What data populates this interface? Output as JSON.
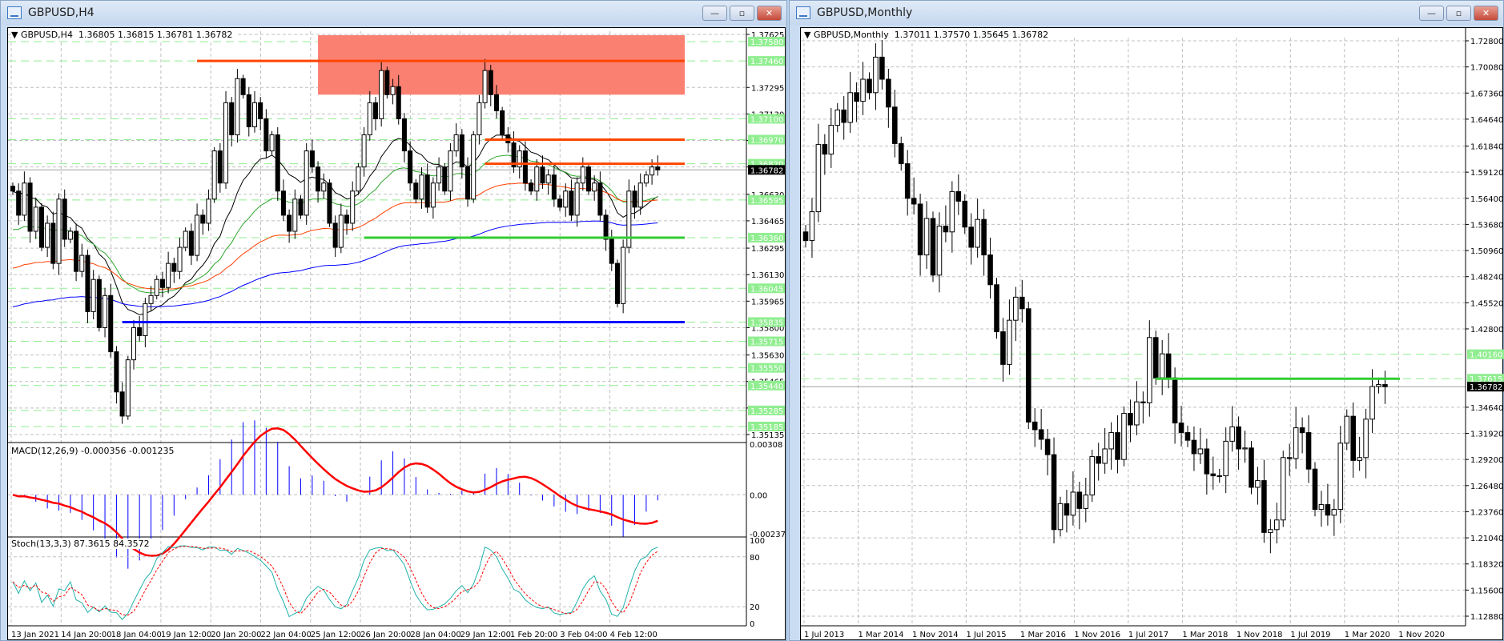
{
  "left_window": {
    "title": "GBPUSD,H4",
    "header": {
      "symbol": "GBPUSD,H4",
      "ohlc": "1.36805 1.36815 1.36781 1.36782"
    },
    "buttons": {
      "minimize": "—",
      "restore": "▫",
      "close": "✕"
    },
    "macd_label": "MACD(12,26,9) -0.000356 -0.001235",
    "stoch_label": "Stoch(13,3,3) 87.3615 84.3572",
    "macd_axis": [
      "0.00308",
      "0.00",
      "-0.00237"
    ],
    "stoch_axis": [
      "100",
      "80",
      "20",
      "0"
    ],
    "current_price": "1.36782",
    "colors": {
      "resist": "#ff4500",
      "zone": "#fa8072",
      "support_green": "#32cd32",
      "support_blue": "#0000ff",
      "level": "#90ee90"
    }
  },
  "right_window": {
    "title": "GBPUSD,Monthly",
    "header": {
      "symbol": "GBPUSD,Monthly",
      "ohlc": "1.37011 1.37570 1.35645 1.36782"
    },
    "buttons": {
      "minimize": "—",
      "restore": "▫",
      "close": "✕"
    },
    "current_price": "1.36782"
  },
  "chart_data": [
    {
      "type": "candlestick",
      "title": "GBPUSD,H4",
      "ylim": [
        1.35135,
        1.37625
      ],
      "y_ticks": [
        "1.37625",
        "1.37295",
        "1.37130",
        "1.36965",
        "1.36800",
        "1.36630",
        "1.36465",
        "1.36295",
        "1.36130",
        "1.35965",
        "1.35800",
        "1.35630",
        "1.35465",
        "1.35300",
        "1.35135"
      ],
      "level_labels": [
        "1.37580",
        "1.37460",
        "1.37100",
        "1.36970",
        "1.36820",
        "1.36595",
        "1.36360",
        "1.36045",
        "1.35835",
        "1.35715",
        "1.35550",
        "1.35440",
        "1.35285",
        "1.35185"
      ],
      "x_labels": [
        "13 Jan 2021",
        "14 Jan 20:00",
        "18 Jan 04:00",
        "19 Jan 12:00",
        "20 Jan 20:00",
        "22 Jan 04:00",
        "25 Jan 12:00",
        "26 Jan 20:00",
        "28 Jan 04:00",
        "29 Jan 12:00",
        "1 Feb 20:00",
        "3 Feb 04:00",
        "4 Feb 12:00"
      ],
      "closes": [
        1.3665,
        1.365,
        1.367,
        1.364,
        1.3655,
        1.363,
        1.3645,
        1.362,
        1.366,
        1.3635,
        1.364,
        1.3615,
        1.3625,
        1.359,
        1.361,
        1.358,
        1.36,
        1.3565,
        1.354,
        1.3525,
        1.356,
        1.358,
        1.3575,
        1.3595,
        1.36,
        1.361,
        1.3605,
        1.362,
        1.3615,
        1.363,
        1.364,
        1.3625,
        1.365,
        1.3645,
        1.366,
        1.369,
        1.367,
        1.372,
        1.37,
        1.3735,
        1.3725,
        1.3705,
        1.372,
        1.371,
        1.369,
        1.37,
        1.3665,
        1.365,
        1.364,
        1.366,
        1.365,
        1.369,
        1.368,
        1.3665,
        1.367,
        1.3645,
        1.363,
        1.365,
        1.3645,
        1.3665,
        1.368,
        1.37,
        1.372,
        1.371,
        1.374,
        1.3725,
        1.373,
        1.371,
        1.369,
        1.367,
        1.366,
        1.3675,
        1.3655,
        1.367,
        1.368,
        1.3665,
        1.369,
        1.37,
        1.368,
        1.366,
        1.37,
        1.372,
        1.374,
        1.3725,
        1.3715,
        1.37,
        1.3695,
        1.368,
        1.369,
        1.367,
        1.3665,
        1.368,
        1.367,
        1.3675,
        1.366,
        1.3655,
        1.3665,
        1.365,
        1.367,
        1.368,
        1.3665,
        1.367,
        1.365,
        1.3635,
        1.362,
        1.3595,
        1.363,
        1.3665,
        1.3655,
        1.367,
        1.3675,
        1.368,
        1.36782
      ],
      "zones": [
        {
          "from": 1.3725,
          "to": 1.3762,
          "start_index": 53
        }
      ],
      "lines": [
        {
          "price": 1.3746,
          "start_index": 32,
          "color": "resist"
        },
        {
          "price": 1.3697,
          "start_index": 82,
          "color": "resist"
        },
        {
          "price": 1.3682,
          "start_index": 82,
          "color": "resist"
        },
        {
          "price": 1.3636,
          "start_index": 61,
          "color": "support_green"
        },
        {
          "price": 1.35835,
          "start_index": 19,
          "color": "support_blue"
        }
      ]
    },
    {
      "type": "candlestick",
      "title": "GBPUSD,Monthly",
      "ylim": [
        1.1288,
        1.728
      ],
      "y_ticks": [
        "1.72800",
        "1.70080",
        "1.67360",
        "1.64640",
        "1.61840",
        "1.59120",
        "1.56400",
        "1.53680",
        "1.50960",
        "1.48240",
        "1.45520",
        "1.42800",
        "1.34640",
        "1.31920",
        "1.29200",
        "1.26480",
        "1.23760",
        "1.21040",
        "1.18320",
        "1.15600",
        "1.12880"
      ],
      "level_labels": [
        "1.40160",
        "1.37615"
      ],
      "x_labels": [
        "1 Jul 2013",
        "1 Mar 2014",
        "1 Nov 2014",
        "1 Jul 2015",
        "1 Mar 2016",
        "1 Nov 2016",
        "1 Jul 2017",
        "1 Mar 2018",
        "1 Nov 2018",
        "1 Jul 2019",
        "1 Mar 2020",
        "1 Nov 2020"
      ],
      "closes": [
        1.52,
        1.55,
        1.62,
        1.61,
        1.64,
        1.656,
        1.643,
        1.674,
        1.665,
        1.688,
        1.674,
        1.711,
        1.688,
        1.659,
        1.621,
        1.6,
        1.564,
        1.558,
        1.505,
        1.543,
        1.484,
        1.535,
        1.529,
        1.571,
        1.561,
        1.534,
        1.513,
        1.542,
        1.505,
        1.474,
        1.425,
        1.391,
        1.437,
        1.461,
        1.449,
        1.331,
        1.323,
        1.313,
        1.297,
        1.219,
        1.246,
        1.234,
        1.258,
        1.241,
        1.255,
        1.295,
        1.288,
        1.303,
        1.32,
        1.292,
        1.34,
        1.328,
        1.352,
        1.351,
        1.419,
        1.377,
        1.402,
        1.377,
        1.33,
        1.32,
        1.312,
        1.298,
        1.303,
        1.277,
        1.275,
        1.275,
        1.311,
        1.326,
        1.303,
        1.304,
        1.263,
        1.27,
        1.216,
        1.219,
        1.229,
        1.294,
        1.293,
        1.325,
        1.32,
        1.282,
        1.24,
        1.245,
        1.234,
        1.24,
        1.309,
        1.337,
        1.291,
        1.294,
        1.334,
        1.368,
        1.37,
        1.36782
      ],
      "lines": [
        {
          "price": 1.37615,
          "start_index": 55,
          "color": "support_green"
        }
      ]
    }
  ]
}
